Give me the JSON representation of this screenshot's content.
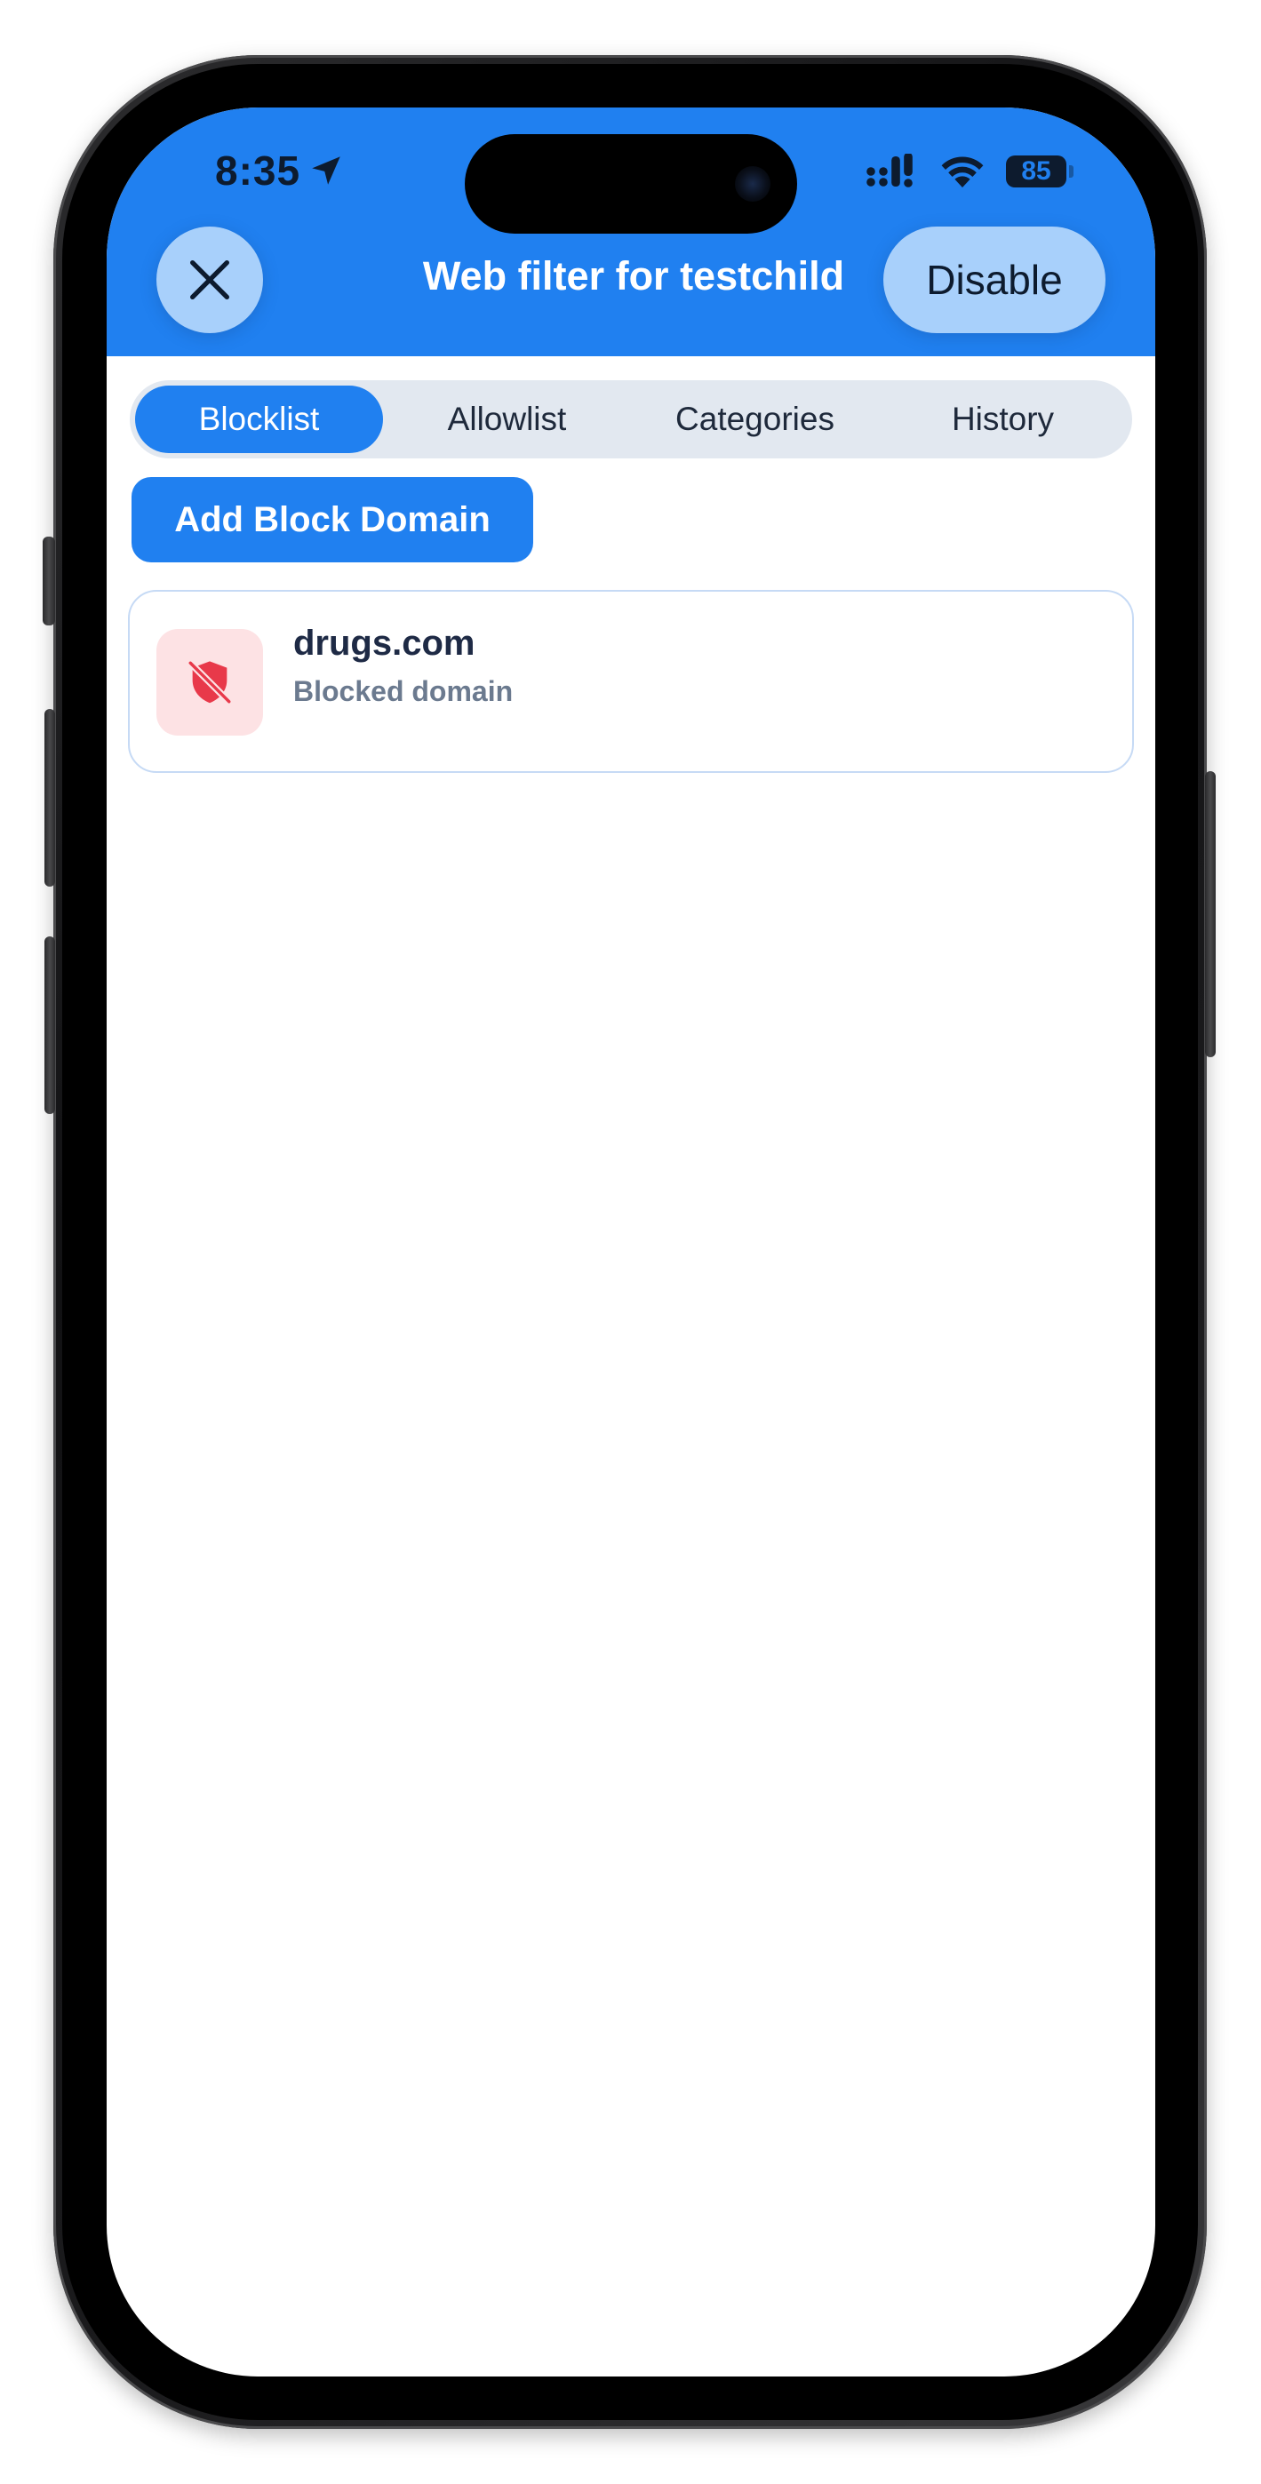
{
  "status_bar": {
    "time": "8:35",
    "battery": "85"
  },
  "header": {
    "title": "Web filter for testchild",
    "disable_label": "Disable",
    "close_icon": "close-icon"
  },
  "tabs": [
    {
      "label": "Blocklist",
      "active": true
    },
    {
      "label": "Allowlist",
      "active": false
    },
    {
      "label": "Categories",
      "active": false
    },
    {
      "label": "History",
      "active": false
    }
  ],
  "actions": {
    "add_label": "Add Block Domain"
  },
  "blocklist": [
    {
      "domain": "drugs.com",
      "subtitle": "Blocked domain",
      "icon": "shield-slash-icon"
    }
  ],
  "colors": {
    "accent": "#2080f0",
    "accent_light": "#a8d0fb",
    "blocked_icon": "#e8394a",
    "blocked_bg": "#fde2e4"
  }
}
